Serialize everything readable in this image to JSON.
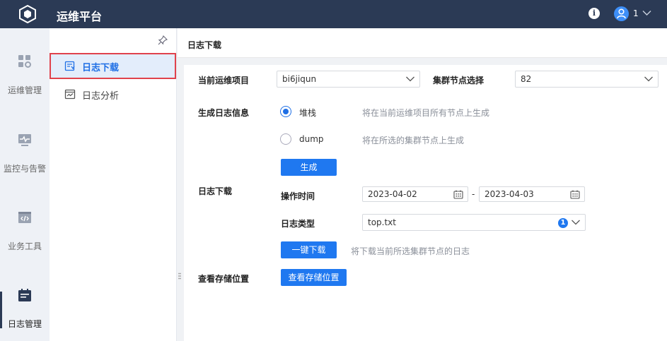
{
  "app": {
    "title": "运维平台"
  },
  "header": {
    "user_count": "1"
  },
  "rail": {
    "items": [
      {
        "label": "运维管理",
        "icon": "dashboard-icon"
      },
      {
        "label": "监控与告警",
        "icon": "monitor-icon"
      },
      {
        "label": "业务工具",
        "icon": "code-window-icon"
      },
      {
        "label": "日志管理",
        "icon": "log-calendar-icon"
      }
    ]
  },
  "submenu": {
    "items": [
      {
        "label": "日志下载",
        "icon": "log-download-icon",
        "active": true
      },
      {
        "label": "日志分析",
        "icon": "log-analysis-icon",
        "active": false
      }
    ]
  },
  "page": {
    "title": "日志下载"
  },
  "form": {
    "project_label": "当前运维项目",
    "project_value": "bi6jiqun",
    "node_label": "集群节点选择",
    "node_value": "82",
    "gen_label": "生成日志信息",
    "radio_stack_label": "堆栈",
    "radio_stack_hint": "将在当前运维项目所有节点上生成",
    "radio_dump_label": "dump",
    "radio_dump_hint": "将在所选的集群节点上生成",
    "generate_button": "生成",
    "download_label": "日志下载",
    "time_label": "操作时间",
    "date_start": "2023-04-02",
    "date_sep": "-",
    "date_end": "2023-04-03",
    "type_label": "日志类型",
    "type_value": "top.txt",
    "type_count": "1",
    "download_button": "一键下载",
    "download_hint": "将下载当前所选集群节点的日志",
    "storage_label": "查看存储位置",
    "storage_button": "查看存储位置"
  },
  "colors": {
    "topbar": "#2b3a55",
    "accent": "#1f78f0",
    "active_outline": "#e0424c"
  }
}
